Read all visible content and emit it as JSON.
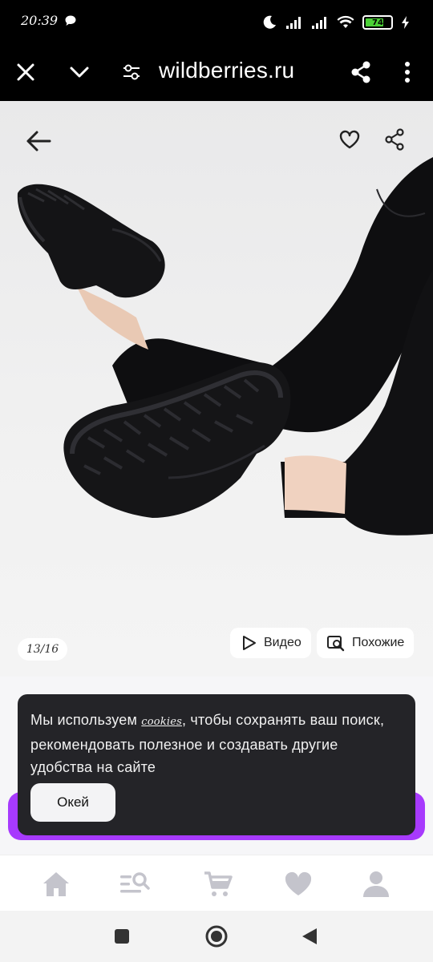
{
  "status_bar": {
    "time": "20:39",
    "battery": "74",
    "icons": [
      "message-icon",
      "moon-icon",
      "signal-icon",
      "signal-icon",
      "wifi-icon",
      "battery-icon",
      "charging-icon"
    ]
  },
  "browser": {
    "url": "wildberries.ru",
    "icons": [
      "close-icon",
      "chevron-down-icon",
      "site-settings-icon",
      "share-icon",
      "more-icon"
    ]
  },
  "product": {
    "image_counter": "13/16",
    "video_label": "Видео",
    "similar_label": "Похожие",
    "icons": [
      "back-arrow-icon",
      "heart-icon",
      "share-icon",
      "play-icon",
      "image-search-icon"
    ]
  },
  "cookie_banner": {
    "text_before": "Мы используем ",
    "cookies_word": "cookies",
    "text_after": ", чтобы сохранять ваш поиск, рекомендовать полезное и создавать другие удобства на сайте",
    "ok_label": "Окей"
  },
  "tab_bar": {
    "icons": [
      "home-icon",
      "catalog-search-icon",
      "cart-icon",
      "favorites-icon",
      "profile-icon"
    ],
    "color": "#c4c4cc"
  },
  "nav": {
    "icons": [
      "recent-apps-icon",
      "home-circle-icon",
      "back-triangle-icon"
    ]
  },
  "colors": {
    "accent": "#a73afd",
    "banner_bg": "#242428"
  }
}
